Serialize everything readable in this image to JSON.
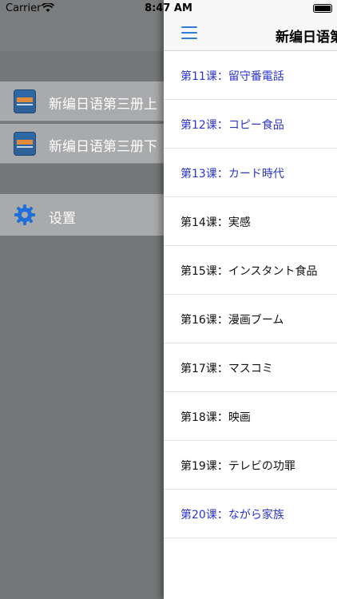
{
  "status": {
    "carrier": "Carrier",
    "time": "8:47 AM"
  },
  "sidebar": {
    "items": [
      {
        "label": "新编日语第三册上",
        "icon": "book-icon"
      },
      {
        "label": "新编日语第三册下",
        "icon": "book-icon"
      }
    ],
    "settings": {
      "label": "设置",
      "icon": "gear-icon"
    }
  },
  "panel": {
    "title": "新编日语第",
    "lessons": [
      {
        "label": "第11课：留守番電話",
        "color": "#2b35c8"
      },
      {
        "label": "第12课：コピー食品",
        "color": "#2b35c8"
      },
      {
        "label": "第13课：カード時代",
        "color": "#2b35c8"
      },
      {
        "label": "第14课：実感",
        "color": "#111111"
      },
      {
        "label": "第15课：インスタント食品",
        "color": "#111111"
      },
      {
        "label": "第16课：漫画ブーム",
        "color": "#111111"
      },
      {
        "label": "第17课：マスコミ",
        "color": "#111111"
      },
      {
        "label": "第18课：映画",
        "color": "#111111"
      },
      {
        "label": "第19课：テレビの功罪",
        "color": "#111111"
      },
      {
        "label": "第20课：ながら家族",
        "color": "#2b35c8"
      }
    ]
  }
}
